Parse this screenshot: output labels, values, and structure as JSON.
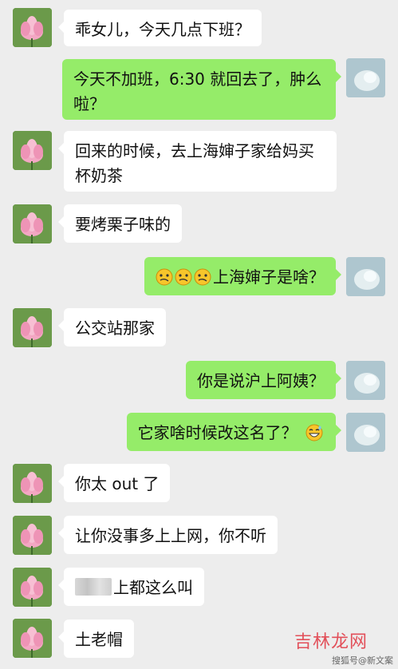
{
  "messages": [
    {
      "side": "left",
      "text": "乖女儿，今天几点下班？"
    },
    {
      "side": "right",
      "text": "今天不加班，6:30 就回去了，肿么啦？"
    },
    {
      "side": "left",
      "text": "回来的时候，去上海婶子家给妈买杯奶茶"
    },
    {
      "side": "left",
      "text": "要烤栗子味的"
    },
    {
      "side": "right",
      "text": "上海婶子是啥？",
      "prefix_emojis": [
        "confused-face-icon",
        "confused-face-icon",
        "confused-face-icon"
      ]
    },
    {
      "side": "left",
      "text": "公交站那家"
    },
    {
      "side": "right",
      "text": "你是说沪上阿姨？"
    },
    {
      "side": "right",
      "text": "它家啥时候改这名了？",
      "suffix_emoji": "laughing-sweat-face-icon"
    },
    {
      "side": "left",
      "text": "你太 out 了"
    },
    {
      "side": "left",
      "text": "让你没事多上上网，你不听"
    },
    {
      "side": "left",
      "text": "上都这么叫",
      "redacted_prefix": true
    },
    {
      "side": "left",
      "text": "土老帽"
    }
  ],
  "watermark": {
    "logo": "吉林龙网",
    "source": "搜狐号@新文案"
  },
  "colors": {
    "bg": "#ededed",
    "self_bubble": "#95ec69",
    "other_bubble": "#ffffff"
  }
}
